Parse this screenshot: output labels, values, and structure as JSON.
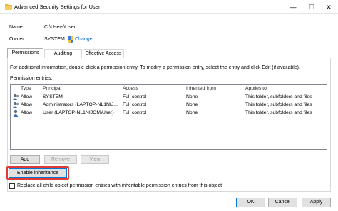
{
  "window": {
    "title": "Advanced Security Settings for User",
    "minimize_glyph": "—",
    "maximize_glyph": "☐",
    "close_glyph": "✕"
  },
  "info": {
    "name_label": "Name:",
    "name_value": "C:\\Users\\User",
    "owner_label": "Owner:",
    "owner_value": "SYSTEM",
    "change_link": "Change"
  },
  "tabs": [
    {
      "label": "Permissions",
      "active": true
    },
    {
      "label": "Auditing",
      "active": false
    },
    {
      "label": "Effective Access",
      "active": false
    }
  ],
  "panel": {
    "info_text": "For additional information, double-click a permission entry. To modify a permission entry, select the entry and click Edit (if available).",
    "entries_label": "Permission entries:"
  },
  "table": {
    "headers": [
      "Type",
      "Principal",
      "Access",
      "Inherited from",
      "Applies to"
    ],
    "rows": [
      {
        "type": "Allow",
        "principal": "SYSTEM",
        "access": "Full control",
        "inherited_from": "None",
        "applies_to": "This folder, subfolders and files"
      },
      {
        "type": "Allow",
        "principal": "Administrators (LAPTOP-NL1NIJ...",
        "access": "Full control",
        "inherited_from": "None",
        "applies_to": "This folder, subfolders and files"
      },
      {
        "type": "Allow",
        "principal": "User (LAPTOP-NL1NIJOM\\User)",
        "access": "Full control",
        "inherited_from": "None",
        "applies_to": "This folder, subfolders and files"
      }
    ]
  },
  "buttons": {
    "add": "Add",
    "remove": "Remove",
    "view": "View",
    "enable_inheritance": "Enable inheritance"
  },
  "replace_checkbox": {
    "label": "Replace all child object permission entries with inheritable permission entries from this object",
    "checked": false
  },
  "footer": {
    "ok": "OK",
    "cancel": "Cancel",
    "apply": "Apply"
  },
  "colors": {
    "link": "#0066cc",
    "highlight": "#e53935",
    "focus": "#0078d7"
  }
}
